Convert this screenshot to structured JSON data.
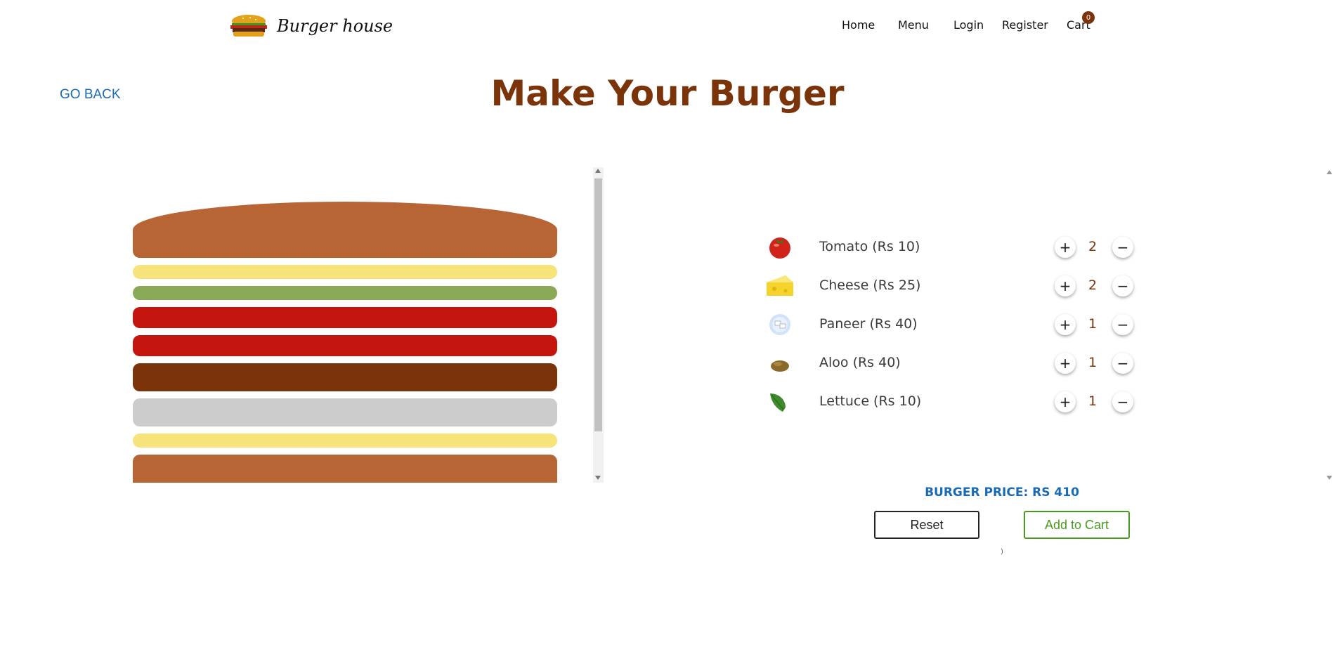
{
  "header": {
    "brand": "Burger house",
    "nav": {
      "home": "Home",
      "menu": "Menu",
      "login": "Login",
      "register": "Register",
      "cart": "Cart",
      "cart_count": "0"
    }
  },
  "page": {
    "go_back": "GO BACK",
    "title": "Make Your Burger"
  },
  "burger_layers": [
    {
      "type": "bun-top",
      "color": "#b86536"
    },
    {
      "type": "cheese",
      "color": "#f6e37a"
    },
    {
      "type": "lettuce",
      "color": "#8aa957"
    },
    {
      "type": "tomato",
      "color": "#c4150f"
    },
    {
      "type": "tomato",
      "color": "#c4150f"
    },
    {
      "type": "aloo",
      "color": "#7b3309"
    },
    {
      "type": "paneer",
      "color": "#cccccc"
    },
    {
      "type": "cheese",
      "color": "#f6e37a"
    },
    {
      "type": "bun-bottom",
      "color": "#b86536"
    }
  ],
  "ingredients": [
    {
      "name": "Tomato (Rs 10)",
      "icon": "tomato-icon",
      "qty": "2"
    },
    {
      "name": "Cheese (Rs 25)",
      "icon": "cheese-icon",
      "qty": "2"
    },
    {
      "name": "Paneer (Rs 40)",
      "icon": "paneer-icon",
      "qty": "1"
    },
    {
      "name": "Aloo (Rs 40)",
      "icon": "potato-icon",
      "qty": "1"
    },
    {
      "name": "Lettuce (Rs 10)",
      "icon": "lettuce-icon",
      "qty": "1"
    }
  ],
  "controls": {
    "plus": "+",
    "minus": "−"
  },
  "summary": {
    "price_label": "BURGER PRICE: RS 410",
    "reset": "Reset",
    "add_to_cart": "Add to Cart",
    "mark": ")"
  },
  "colors": {
    "accent_brown": "#7b3309",
    "link_blue": "#1a6bb3",
    "add_green": "#4a9a1f"
  }
}
